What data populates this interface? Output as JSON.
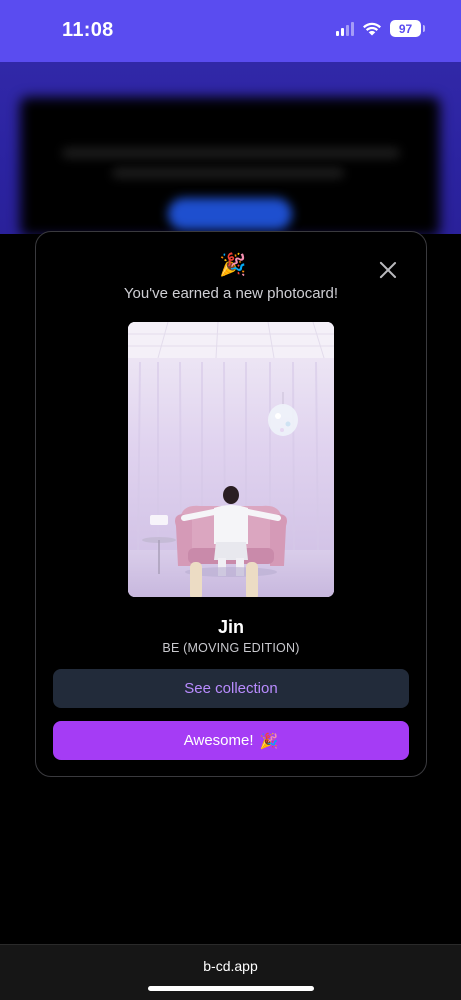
{
  "status_bar": {
    "time": "11:08",
    "battery": "97",
    "color": "#5a4cf0"
  },
  "modal": {
    "message": "You've earned a new photocard!",
    "celebration_icon": "party-popper-icon",
    "close_icon": "close-icon",
    "card": {
      "name": "Jin",
      "album": "BE (MOVING EDITION)"
    },
    "buttons": {
      "see_collection": "See collection",
      "awesome": "Awesome!",
      "awesome_emoji": "🎉"
    }
  },
  "browser": {
    "url": "b-cd.app"
  },
  "colors": {
    "accent_purple": "#a53cf5",
    "collection_button_bg": "#222b3a",
    "collection_button_text": "#b98cff"
  }
}
